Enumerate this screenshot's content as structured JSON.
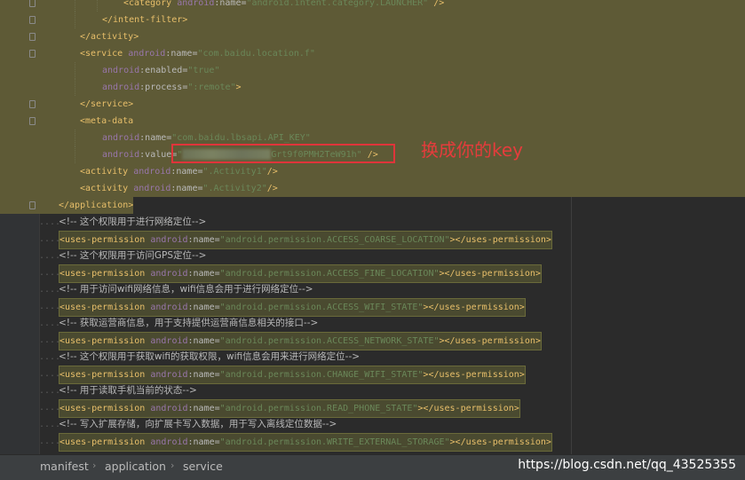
{
  "code_lines": [
    {
      "parts": [
        {
          "c": "tag",
          "t": "<category "
        },
        {
          "c": "ns",
          "t": "android"
        },
        {
          "c": "attr",
          "t": ":name="
        },
        {
          "c": "val",
          "t": "\"android.intent.category.LAUNCHER\""
        },
        {
          "c": "tag",
          "t": " />"
        }
      ]
    },
    {
      "parts": [
        {
          "c": "tag",
          "t": "</intent-filter>"
        }
      ]
    },
    {
      "parts": [
        {
          "c": "tag",
          "t": "</activity>"
        }
      ]
    },
    {
      "parts": [
        {
          "c": "tag",
          "t": "<service "
        },
        {
          "c": "ns",
          "t": "android"
        },
        {
          "c": "attr",
          "t": ":name="
        },
        {
          "c": "val",
          "t": "\"com.baidu.location.f\""
        }
      ]
    },
    {
      "parts": [
        {
          "c": "ns",
          "t": "android"
        },
        {
          "c": "attr",
          "t": ":enabled="
        },
        {
          "c": "val",
          "t": "\"true\""
        }
      ]
    },
    {
      "parts": [
        {
          "c": "ns",
          "t": "android"
        },
        {
          "c": "attr",
          "t": ":process="
        },
        {
          "c": "val",
          "t": "\":remote\""
        },
        {
          "c": "tag",
          "t": ">"
        }
      ]
    },
    {
      "parts": [
        {
          "c": "tag",
          "t": "</service>"
        }
      ]
    },
    {
      "parts": [
        {
          "c": "tag",
          "t": "<meta-data"
        }
      ]
    },
    {
      "parts": [
        {
          "c": "ns",
          "t": "android"
        },
        {
          "c": "attr",
          "t": ":name="
        },
        {
          "c": "val",
          "t": "\"com.baidu.lbsapi.API_KEY\""
        }
      ]
    },
    {
      "parts": [
        {
          "c": "ns",
          "t": "android"
        },
        {
          "c": "attr",
          "t": ":value="
        },
        {
          "c": "val",
          "t": "\""
        },
        {
          "c": "blur",
          "t": ""
        },
        {
          "c": "val",
          "t": "Grt9f0PMH2TeW91h\""
        },
        {
          "c": "tag",
          "t": " />"
        }
      ]
    },
    {
      "parts": [
        {
          "c": "tag",
          "t": "<activity "
        },
        {
          "c": "ns",
          "t": "android"
        },
        {
          "c": "attr",
          "t": ":name="
        },
        {
          "c": "val",
          "t": "\".Activity1\""
        },
        {
          "c": "tag",
          "t": "/>"
        }
      ]
    },
    {
      "parts": [
        {
          "c": "tag",
          "t": "<activity "
        },
        {
          "c": "ns",
          "t": "android"
        },
        {
          "c": "attr",
          "t": ":name="
        },
        {
          "c": "val",
          "t": "\".Activity2\""
        },
        {
          "c": "tag",
          "t": "/>"
        }
      ]
    },
    {
      "parts": [
        {
          "c": "tag",
          "t": "</application>"
        }
      ]
    },
    {
      "parts": [
        {
          "c": "cmt",
          "t": "<!-- 这个权限用于进行网络定位-->"
        }
      ]
    },
    {
      "parts": [
        {
          "c": "tag",
          "t": "<uses-permission "
        },
        {
          "c": "ns",
          "t": "android"
        },
        {
          "c": "attr",
          "t": ":name="
        },
        {
          "c": "val",
          "t": "\"android.permission.ACCESS_COARSE_LOCATION\""
        },
        {
          "c": "tag",
          "t": "></uses-permission>"
        }
      ]
    },
    {
      "parts": [
        {
          "c": "cmt",
          "t": "<!-- 这个权限用于访问GPS定位-->"
        }
      ]
    },
    {
      "parts": [
        {
          "c": "tag",
          "t": "<uses-permission "
        },
        {
          "c": "ns",
          "t": "android"
        },
        {
          "c": "attr",
          "t": ":name="
        },
        {
          "c": "val",
          "t": "\"android.permission.ACCESS_FINE_LOCATION\""
        },
        {
          "c": "tag",
          "t": "></uses-permission>"
        }
      ]
    },
    {
      "parts": [
        {
          "c": "cmt",
          "t": "<!-- 用于访问wifi网络信息，wifi信息会用于进行网络定位-->"
        }
      ]
    },
    {
      "parts": [
        {
          "c": "tag",
          "t": "<uses-permission "
        },
        {
          "c": "ns",
          "t": "android"
        },
        {
          "c": "attr",
          "t": ":name="
        },
        {
          "c": "val",
          "t": "\"android.permission.ACCESS_WIFI_STATE\""
        },
        {
          "c": "tag",
          "t": "></uses-permission>"
        }
      ]
    },
    {
      "parts": [
        {
          "c": "cmt",
          "t": "<!-- 获取运营商信息，用于支持提供运营商信息相关的接口-->"
        }
      ]
    },
    {
      "parts": [
        {
          "c": "tag",
          "t": "<uses-permission "
        },
        {
          "c": "ns",
          "t": "android"
        },
        {
          "c": "attr",
          "t": ":name="
        },
        {
          "c": "val",
          "t": "\"android.permission.ACCESS_NETWORK_STATE\""
        },
        {
          "c": "tag",
          "t": "></uses-permission>"
        }
      ]
    },
    {
      "parts": [
        {
          "c": "cmt",
          "t": "<!-- 这个权限用于获取wifi的获取权限，wifi信息会用来进行网络定位-->"
        }
      ]
    },
    {
      "parts": [
        {
          "c": "tag",
          "t": "<uses-permission "
        },
        {
          "c": "ns",
          "t": "android"
        },
        {
          "c": "attr",
          "t": ":name="
        },
        {
          "c": "val",
          "t": "\"android.permission.CHANGE_WIFI_STATE\""
        },
        {
          "c": "tag",
          "t": "></uses-permission>"
        }
      ]
    },
    {
      "parts": [
        {
          "c": "cmt",
          "t": "<!-- 用于读取手机当前的状态-->"
        }
      ]
    },
    {
      "parts": [
        {
          "c": "tag",
          "t": "<uses-permission "
        },
        {
          "c": "ns",
          "t": "android"
        },
        {
          "c": "attr",
          "t": ":name="
        },
        {
          "c": "val",
          "t": "\"android.permission.READ_PHONE_STATE\""
        },
        {
          "c": "tag",
          "t": "></uses-permission>"
        }
      ]
    },
    {
      "parts": [
        {
          "c": "cmt",
          "t": "<!-- 写入扩展存储，向扩展卡写入数据，用于写入离线定位数据-->"
        }
      ]
    },
    {
      "parts": [
        {
          "c": "tag",
          "t": "<uses-permission "
        },
        {
          "c": "ns",
          "t": "android"
        },
        {
          "c": "attr",
          "t": ":name="
        },
        {
          "c": "val",
          "t": "\"android.permission.WRITE_EXTERNAL_STORAGE\""
        },
        {
          "c": "tag",
          "t": "></uses-permission>"
        }
      ]
    }
  ],
  "annotation": {
    "text": "换成你的key",
    "color": "#e53c3c"
  },
  "breadcrumb": [
    "manifest",
    "application",
    "service"
  ],
  "watermark": "https://blog.csdn.net/qq_43525355",
  "colors": {
    "highlight": "#5e5a36",
    "background": "#2b2b2b",
    "statusbar": "#3c3f41"
  }
}
